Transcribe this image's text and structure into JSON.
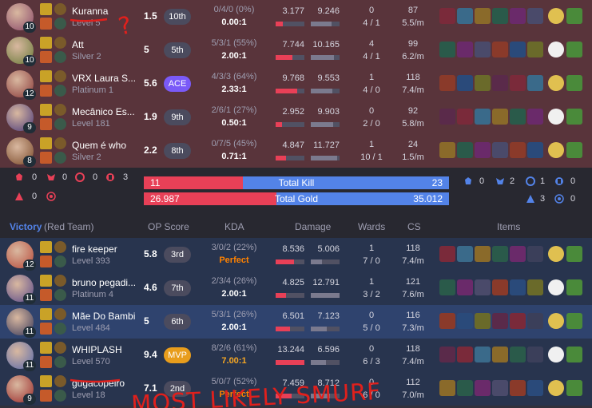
{
  "red_team_header": {
    "result": "Victory",
    "team": "(Red Team)",
    "op_score": "OP Score",
    "kda": "KDA",
    "damage": "Damage",
    "wards": "Wards",
    "cs": "CS",
    "items": "Items"
  },
  "summary": {
    "left_objectives": [
      "0",
      "0",
      "0",
      "3",
      "0"
    ],
    "right_objectives": [
      "0",
      "2",
      "1",
      "0",
      "3",
      "0"
    ],
    "kill_bar": {
      "left": "11",
      "label": "Total Kill",
      "right": "23",
      "left_fraction": 0.324
    },
    "gold_bar": {
      "left": "26.987",
      "label": "Total Gold",
      "right": "35.012",
      "left_fraction": 0.435
    }
  },
  "defeat_players": [
    {
      "name": "Kuranna",
      "rank": "Level 5",
      "level": "10",
      "op_score": "1.5",
      "badge": "10th",
      "kda_stats": "0/4/0 (0%)",
      "kda_ratio": "0.00:1",
      "damage_dealt": "3.177",
      "damage_taken": "9.246",
      "dealt_frac": 0.24,
      "taken_frac": 0.72,
      "wards_top": "0",
      "wards_bottom": "4 / 1",
      "cs_top": "87",
      "cs_bottom": "5.5/m"
    },
    {
      "name": "Att",
      "rank": "Silver 2",
      "level": "10",
      "op_score": "5",
      "badge": "5th",
      "kda_stats": "5/3/1 (55%)",
      "kda_ratio": "2.00:1",
      "damage_dealt": "7.744",
      "damage_taken": "10.165",
      "dealt_frac": 0.59,
      "taken_frac": 0.8,
      "wards_top": "4",
      "wards_bottom": "4 / 1",
      "cs_top": "99",
      "cs_bottom": "6.2/m"
    },
    {
      "name": "VRX Laura S...",
      "rank": "Platinum 1",
      "level": "12",
      "op_score": "5.6",
      "badge": "ACE",
      "kda_stats": "4/3/3 (64%)",
      "kda_ratio": "2.33:1",
      "damage_dealt": "9.768",
      "damage_taken": "9.553",
      "dealt_frac": 0.74,
      "taken_frac": 0.75,
      "wards_top": "1",
      "wards_bottom": "4 / 0",
      "cs_top": "118",
      "cs_bottom": "7.4/m"
    },
    {
      "name": "Mecânico Es...",
      "rank": "Level 181",
      "level": "9",
      "op_score": "1.9",
      "badge": "9th",
      "kda_stats": "2/6/1 (27%)",
      "kda_ratio": "0.50:1",
      "damage_dealt": "2.952",
      "damage_taken": "9.903",
      "dealt_frac": 0.22,
      "taken_frac": 0.78,
      "wards_top": "0",
      "wards_bottom": "2 / 0",
      "cs_top": "92",
      "cs_bottom": "5.8/m"
    },
    {
      "name": "Quem é who",
      "rank": "Silver 2",
      "level": "8",
      "op_score": "2.2",
      "badge": "8th",
      "kda_stats": "0/7/5 (45%)",
      "kda_ratio": "0.71:1",
      "damage_dealt": "4.847",
      "damage_taken": "11.727",
      "dealt_frac": 0.37,
      "taken_frac": 0.92,
      "wards_top": "1",
      "wards_bottom": "10 / 1",
      "cs_top": "24",
      "cs_bottom": "1.5/m"
    }
  ],
  "victory_players": [
    {
      "name": "fire keeper",
      "rank": "Level 393",
      "level": "12",
      "op_score": "5.8",
      "badge": "3rd",
      "kda_stats": "3/0/2 (22%)",
      "kda_ratio": "Perfect",
      "damage_dealt": "8.536",
      "damage_taken": "5.006",
      "dealt_frac": 0.65,
      "taken_frac": 0.39,
      "wards_top": "1",
      "wards_bottom": "7 / 0",
      "cs_top": "118",
      "cs_bottom": "7.4/m"
    },
    {
      "name": "bruno pegadi...",
      "rank": "Platinum 4",
      "level": "11",
      "op_score": "4.6",
      "badge": "7th",
      "kda_stats": "2/3/4 (26%)",
      "kda_ratio": "2.00:1",
      "damage_dealt": "4.825",
      "damage_taken": "12.791",
      "dealt_frac": 0.37,
      "taken_frac": 1.0,
      "wards_top": "1",
      "wards_bottom": "3 / 2",
      "cs_top": "121",
      "cs_bottom": "7.6/m"
    },
    {
      "name": "Mãe Do Bambi",
      "rank": "Level 484",
      "level": "11",
      "op_score": "5",
      "badge": "6th",
      "kda_stats": "5/3/1 (26%)",
      "kda_ratio": "2.00:1",
      "damage_dealt": "6.501",
      "damage_taken": "7.123",
      "dealt_frac": 0.49,
      "taken_frac": 0.56,
      "wards_top": "0",
      "wards_bottom": "5 / 0",
      "cs_top": "116",
      "cs_bottom": "7.3/m"
    },
    {
      "name": "WHIPLASH",
      "rank": "Level 570",
      "level": "11",
      "op_score": "9.4",
      "badge": "MVP",
      "kda_stats": "8/2/6 (61%)",
      "kda_ratio": "7.00:1",
      "damage_dealt": "13.244",
      "damage_taken": "6.596",
      "dealt_frac": 1.0,
      "taken_frac": 0.52,
      "wards_top": "0",
      "wards_bottom": "6 / 3",
      "cs_top": "118",
      "cs_bottom": "7.4/m"
    },
    {
      "name": "gugacopeiro",
      "rank": "Level 18",
      "level": "9",
      "op_score": "7.1",
      "badge": "2nd",
      "kda_stats": "5/0/7 (52%)",
      "kda_ratio": "Perfect",
      "damage_dealt": "7.459",
      "damage_taken": "8.712",
      "dealt_frac": 0.56,
      "taken_frac": 0.68,
      "wards_top": "0",
      "wards_bottom": "6 / 0",
      "cs_top": "112",
      "cs_bottom": "7.0/m"
    }
  ],
  "annotations": {
    "question_mark": "?",
    "handwritten_text": "MOST LIKELY SMURF"
  },
  "colors": {
    "defeat_row": "#59343b",
    "victory_row": "#28344e",
    "highlight_row": "#2f436e",
    "kill_red": "#e84057",
    "kill_blue": "#5383e8",
    "annotation_red": "#e0201c",
    "mvp": "#e89d1c",
    "ace": "#7a5af8"
  }
}
